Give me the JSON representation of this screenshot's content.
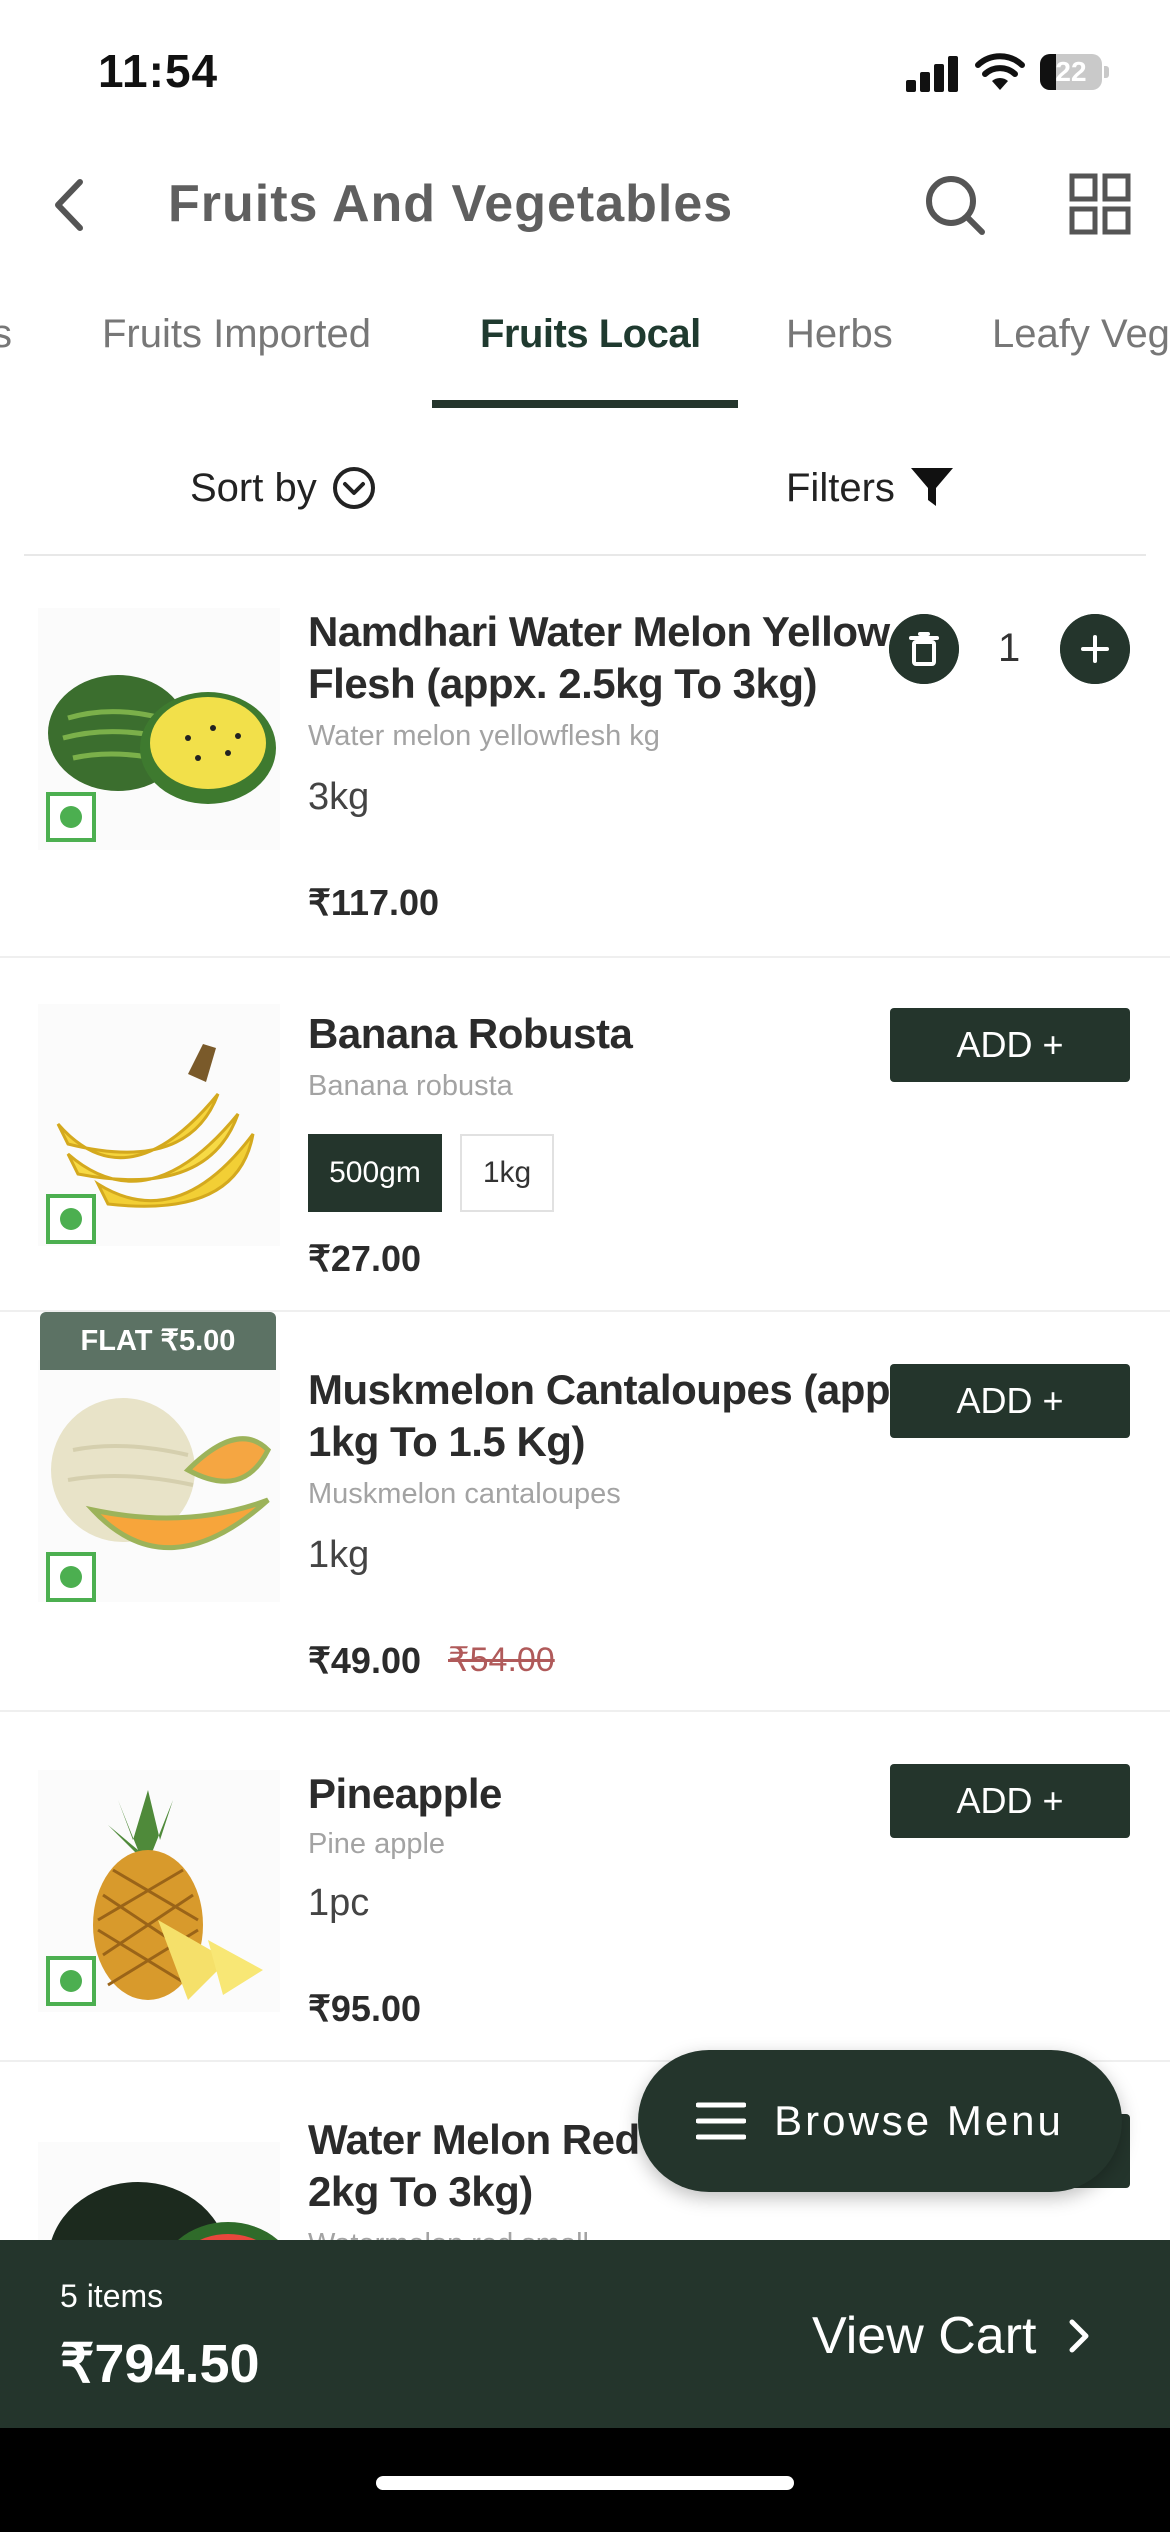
{
  "status_bar": {
    "time": "11:54",
    "battery": "22"
  },
  "header": {
    "title": "Fruits And Vegetables",
    "back_icon": "chevron-left-icon",
    "search_icon": "search-icon",
    "grid_icon": "grid-icon"
  },
  "tabs": [
    {
      "label": "Fruits Imported",
      "active": false
    },
    {
      "label": "Fruits Local",
      "active": true
    },
    {
      "label": "Herbs",
      "active": false
    },
    {
      "label": "Leafy Vege",
      "active": false
    }
  ],
  "sort_label": "Sort by",
  "filter_label": "Filters",
  "products": [
    {
      "name_line1": "Namdhari Water Melon Yellow",
      "name_line2": "Flesh (appx. 2.5kg To 3kg)",
      "subtitle": "Water melon yellowflesh kg",
      "size": "3kg",
      "price": "₹117.00",
      "quantity": "1"
    },
    {
      "name_line1": "Banana Robusta",
      "subtitle": "Banana robusta",
      "variants": [
        "500gm",
        "1kg"
      ],
      "selected_variant": "500gm",
      "price": "₹27.00",
      "add_label": "ADD +"
    },
    {
      "name_line1": "Muskmelon Cantaloupes (appx.",
      "name_line2": "1kg To 1.5 Kg)",
      "subtitle": "Muskmelon cantaloupes",
      "size": "1kg",
      "price": "₹49.00",
      "mrp": "₹54.00",
      "badge": "FLAT ₹5.00",
      "add_label": "ADD +"
    },
    {
      "name_line1": "Pineapple",
      "subtitle": "Pine apple",
      "size": "1pc",
      "price": "₹95.00",
      "add_label": "ADD +"
    },
    {
      "name_line1": "Water Melon Red S",
      "name_line2": "2kg To 3kg)",
      "subtitle": "Watermelon red small"
    }
  ],
  "browse_menu": {
    "label": "Browse Menu",
    "icon": "hamburger-icon"
  },
  "cart": {
    "items_label": "5 items",
    "total": "₹794.50",
    "view_cart_label": "View Cart"
  },
  "colors": {
    "primary": "#24352c",
    "veg": "#4caf50",
    "muted": "#a3a3a3"
  }
}
